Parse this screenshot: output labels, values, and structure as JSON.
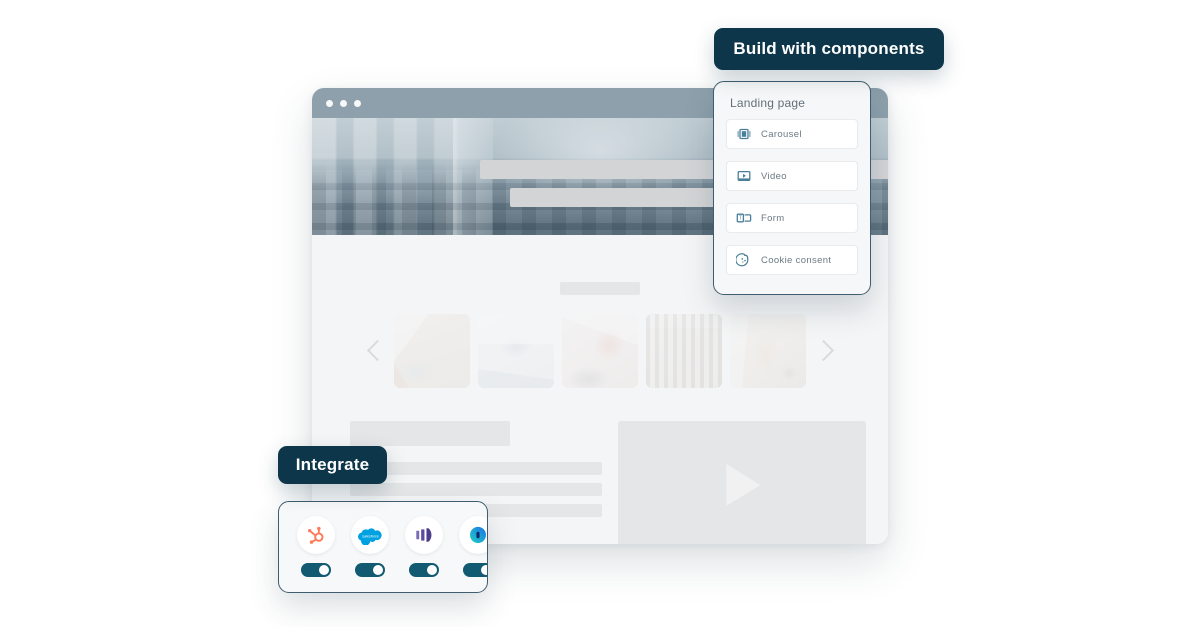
{
  "badges": {
    "build": "Build with components",
    "integrate": "Integrate"
  },
  "components_panel": {
    "title": "Landing page",
    "items": [
      {
        "label": "Carousel",
        "icon": "carousel-icon"
      },
      {
        "label": "Video",
        "icon": "video-icon"
      },
      {
        "label": "Form",
        "icon": "form-icon"
      },
      {
        "label": "Cookie consent",
        "icon": "cookie-icon"
      }
    ]
  },
  "browser": {
    "window_dots": [
      "dot-1",
      "dot-2",
      "dot-3"
    ],
    "carousel": {
      "prev_icon": "chevron-left-icon",
      "next_icon": "chevron-right-icon",
      "thumbnails": [
        "thumbnail-1",
        "thumbnail-2",
        "thumbnail-3",
        "thumbnail-4",
        "thumbnail-5"
      ]
    },
    "video_placeholder_icon": "play-icon"
  },
  "integrations": {
    "items": [
      {
        "name": "HubSpot",
        "icon": "hubspot-logo",
        "color": "#ff7a59",
        "enabled": true
      },
      {
        "name": "Salesforce",
        "icon": "salesforce-logo",
        "color": "#00a1e0",
        "enabled": true
      },
      {
        "name": "Marketo",
        "icon": "marketo-logo",
        "color": "#5c4b9e",
        "enabled": true
      },
      {
        "name": "Analytics",
        "icon": "analytics-logo",
        "color": "#1a73e8",
        "enabled": true
      }
    ],
    "toggle_on_color": "#115a72"
  },
  "colors": {
    "badge_background": "#0e364a",
    "panel_border": "#3f5d70",
    "titlebar": "#8da0ac",
    "page_background": "#ffffff",
    "placeholder": "#e5e6e7"
  }
}
